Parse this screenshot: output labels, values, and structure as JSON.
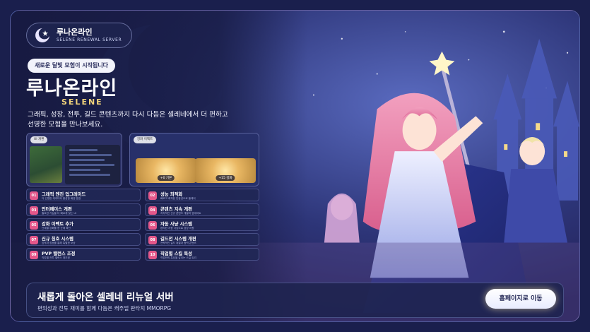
{
  "logo": {
    "name": "루나온라인",
    "tagline": "SELENE RENEWAL SERVER"
  },
  "badge": "새로운 달빛 모험이 시작됩니다",
  "hero": {
    "title": "루나온라인",
    "subtitle": "SELENE",
    "description": "그래픽, 성장, 전투, 길드 콘텐츠까지 다시 다듬은 셀레네에서 더 편하고 선명한 모험을 만나보세요."
  },
  "shots": {
    "ui_tag": "UI 개편",
    "enhance_tag": "강화 이펙트",
    "enhance_before": "+0 기본",
    "enhance_after": "+15 강화"
  },
  "features": [
    {
      "num": "01",
      "title": "그래픽 엔진 업그레이드",
      "sub": "더 선명한 캐릭터와 풍성한 배경 표현"
    },
    {
      "num": "02",
      "title": "성능 최적화",
      "sub": "빠르고 쾌적한 반응성으로 플레이"
    },
    {
      "num": "03",
      "title": "인터페이스 개편",
      "sub": "필요한 기능을 더 빠르게 찾는 UI"
    },
    {
      "num": "04",
      "title": "콘텐츠 지속 개편",
      "sub": "지속적인 신규 콘텐츠 개발과 업데이트"
    },
    {
      "num": "05",
      "title": "강화 이펙트 추가",
      "sub": "단계별 강화를 한 눈에 확인"
    },
    {
      "num": "06",
      "title": "자동 사냥 시스템",
      "sub": "편리한 자동 사냥으로 성장 지원"
    },
    {
      "num": "07",
      "title": "신규 칭호 시스템",
      "sub": "업적과 칭호를 통해 특별한 보상"
    },
    {
      "num": "08",
      "title": "길드전 시스템 개편",
      "sub": "전략적인 길드 대결과 협력 콘텐츠"
    },
    {
      "num": "09",
      "title": "PVP 밸런스 조정",
      "sub": "직업별 전투 밸런스 재조정"
    },
    {
      "num": "10",
      "title": "직업별 스킬 특성",
      "sub": "직업만의 특성을 살리는 스킬 트리"
    }
  ],
  "banner": {
    "title": "새롭게 돌아온 셀레네 리뉴얼 서버",
    "subtitle": "편의성과 전투 재미를 함께 다듬은 캐주얼 판타지 MMORPG",
    "cta": "홈페이지로 이동"
  },
  "colors": {
    "accent": "#e4578a",
    "gold": "#f1d37b",
    "bg": "#1a1f4d"
  }
}
